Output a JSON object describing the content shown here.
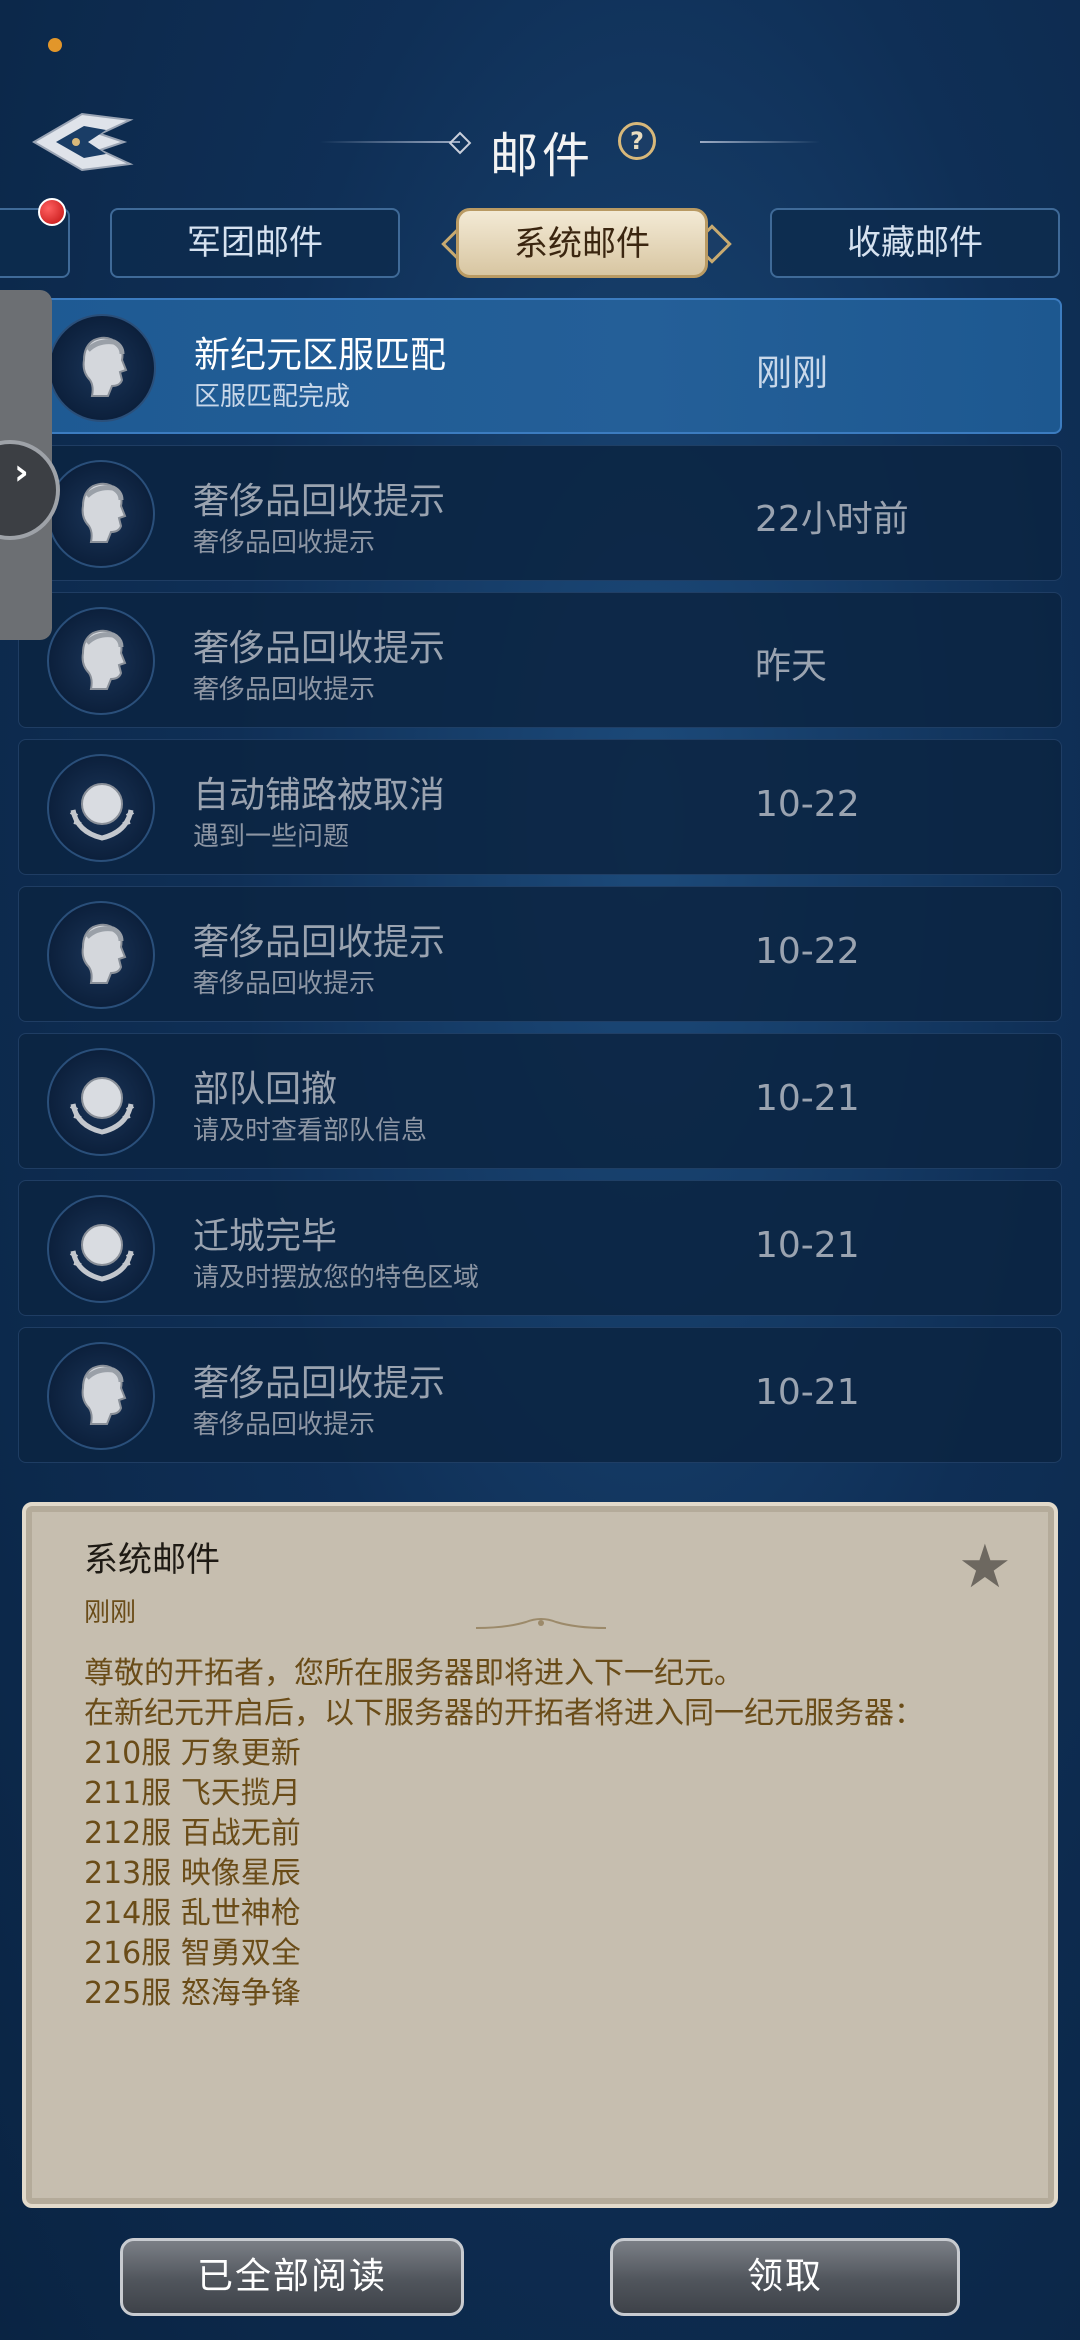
{
  "header": {
    "title": "邮件",
    "help_symbol": "?"
  },
  "tabs": [
    {
      "label": "军团邮件"
    },
    {
      "label": "系统邮件"
    },
    {
      "label": "收藏邮件"
    }
  ],
  "side_drawer": {
    "arrow": "›"
  },
  "mails": [
    {
      "title": "新纪元区服匹配",
      "subtitle": "区服匹配完成",
      "time": "刚刚",
      "icon": "emperor-head-icon",
      "selected": true
    },
    {
      "title": "奢侈品回收提示",
      "subtitle": "奢侈品回收提示",
      "time": "22小时前",
      "icon": "emperor-head-icon"
    },
    {
      "title": "奢侈品回收提示",
      "subtitle": "奢侈品回收提示",
      "time": "昨天",
      "icon": "emperor-head-icon"
    },
    {
      "title": "自动铺路被取消",
      "subtitle": "遇到一些问题",
      "time": "10-22",
      "icon": "globe-laurel-icon"
    },
    {
      "title": "奢侈品回收提示",
      "subtitle": "奢侈品回收提示",
      "time": "10-22",
      "icon": "emperor-head-icon"
    },
    {
      "title": "部队回撤",
      "subtitle": "请及时查看部队信息",
      "time": "10-21",
      "icon": "globe-laurel-icon"
    },
    {
      "title": "迁城完毕",
      "subtitle": "请及时摆放您的特色区域",
      "time": "10-21",
      "icon": "globe-laurel-icon"
    },
    {
      "title": "奢侈品回收提示",
      "subtitle": "奢侈品回收提示",
      "time": "10-21",
      "icon": "emperor-head-icon"
    }
  ],
  "detail": {
    "title": "系统邮件",
    "time": "刚刚",
    "star": "★",
    "lines": [
      "尊敬的开拓者，您所在服务器即将进入下一纪元。",
      "在新纪元开启后，以下服务器的开拓者将进入同一纪元服务器：",
      "210服 万象更新",
      "211服 飞天揽月",
      "212服 百战无前",
      "213服 映像星辰",
      "214服 乱世神枪",
      "216服 智勇双全",
      "225服 怒海争锋"
    ]
  },
  "buttons": {
    "read_all": "已全部阅读",
    "claim": "领取"
  },
  "colors": {
    "background": "#0f2f56",
    "selected_row": "#245f98",
    "panel": "#c6beaf",
    "panel_text": "#6a4c18",
    "badge": "#e02020"
  }
}
